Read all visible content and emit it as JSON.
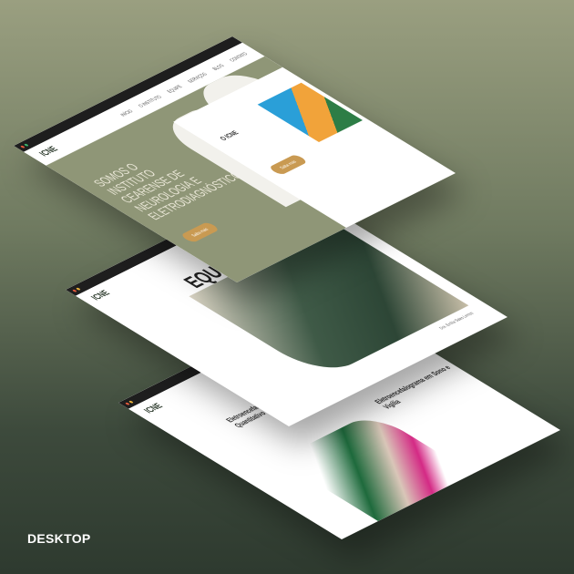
{
  "label": "DESKTOP",
  "site": {
    "logo": "ICNE",
    "nav": [
      "INÍCIO",
      "O INSTITUTO",
      "EQUIPE",
      "SERVIÇOS",
      "BLOG",
      "CONTATO"
    ]
  },
  "hero": {
    "title": "SOMOS O INSTITUTO CEARENSE DE NEUROLOGIA E ELETRODIAGNÓSTICO",
    "button": "Saiba mais"
  },
  "about": {
    "title": "O ICNE",
    "button": "Saiba mais"
  },
  "team": {
    "title": "EQUIPE",
    "caption": "Dra. Emília Sales Lemos"
  },
  "services": [
    {
      "title": "Eletroencefalograma Quantitativo"
    },
    {
      "title": "Eletroencefalograma em Sono e Vigília"
    }
  ],
  "colors": {
    "olive": "#8f9677",
    "gold": "#c99a52",
    "green": "#2d4636"
  }
}
